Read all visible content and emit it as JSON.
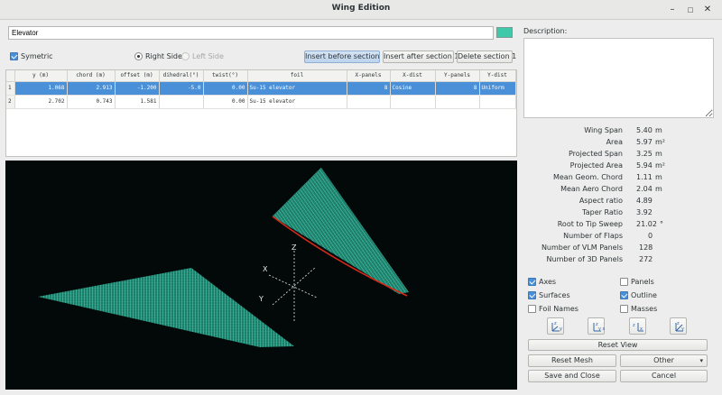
{
  "window": {
    "title": "Wing Edition"
  },
  "wing_name": "Elevator",
  "colors": {
    "wing_color": "#3fc9a9",
    "mesh": "#3fc9a9",
    "outline": "#d12a1a",
    "selection": "#4a90d9"
  },
  "options": {
    "symetric_label": "Symetric",
    "right_side_label": "Right Side",
    "left_side_label": "Left Side"
  },
  "buttons": {
    "insert_before": "Insert before section 1",
    "insert_after": "Insert after section 1",
    "delete_section": "Delete section 1",
    "reset_view": "Reset View",
    "reset_mesh": "Reset Mesh",
    "other": "Other",
    "save_close": "Save and Close",
    "cancel": "Cancel"
  },
  "table": {
    "headers": [
      "y (m)",
      "chord (m)",
      "offset (m)",
      "dihedral(°)",
      "twist(°)",
      "foil",
      "X-panels",
      "X-dist",
      "Y-panels",
      "Y-dist"
    ],
    "rows": [
      {
        "index": "1",
        "cells": [
          "1.068",
          "2.913",
          "-1.200",
          "-5.0",
          "0.00",
          "Su-15 elevator",
          "8",
          "Cosine",
          "8",
          "Uniform"
        ]
      },
      {
        "index": "2",
        "cells": [
          "2.702",
          "0.743",
          "1.581",
          "",
          "0.00",
          "Su-15 elevator",
          "",
          "",
          "",
          ""
        ]
      }
    ]
  },
  "description_label": "Description:",
  "stats": [
    {
      "label": "Wing Span",
      "value": "5.40",
      "unit": "m"
    },
    {
      "label": "Area",
      "value": "5.97",
      "unit": "m²"
    },
    {
      "label": "Projected Span",
      "value": "3.25",
      "unit": "m"
    },
    {
      "label": "Projected Area",
      "value": "5.94",
      "unit": "m²"
    },
    {
      "label": "Mean Geom. Chord",
      "value": "1.11",
      "unit": "m"
    },
    {
      "label": "Mean Aero Chord",
      "value": "2.04",
      "unit": "m"
    },
    {
      "label": "Aspect ratio",
      "value": "4.89",
      "unit": ""
    },
    {
      "label": "Taper Ratio",
      "value": "3.92",
      "unit": ""
    },
    {
      "label": "Root to Tip Sweep",
      "value": "21.02",
      "unit": "°"
    },
    {
      "label": "Number of Flaps",
      "value": "0",
      "unit": ""
    },
    {
      "label": "Number of VLM Panels",
      "value": "128",
      "unit": ""
    },
    {
      "label": "Number of 3D Panels",
      "value": "272",
      "unit": ""
    }
  ],
  "view_options": {
    "axes": "Axes",
    "panels": "Panels",
    "surfaces": "Surfaces",
    "outline": "Outline",
    "foil_names": "Foil Names",
    "masses": "Masses"
  },
  "view_icons": [
    "iso-view-icon",
    "x-view-icon",
    "y-view-icon",
    "z-view-icon"
  ],
  "axis_labels": {
    "x": "X",
    "y": "Y",
    "z": "Z"
  }
}
